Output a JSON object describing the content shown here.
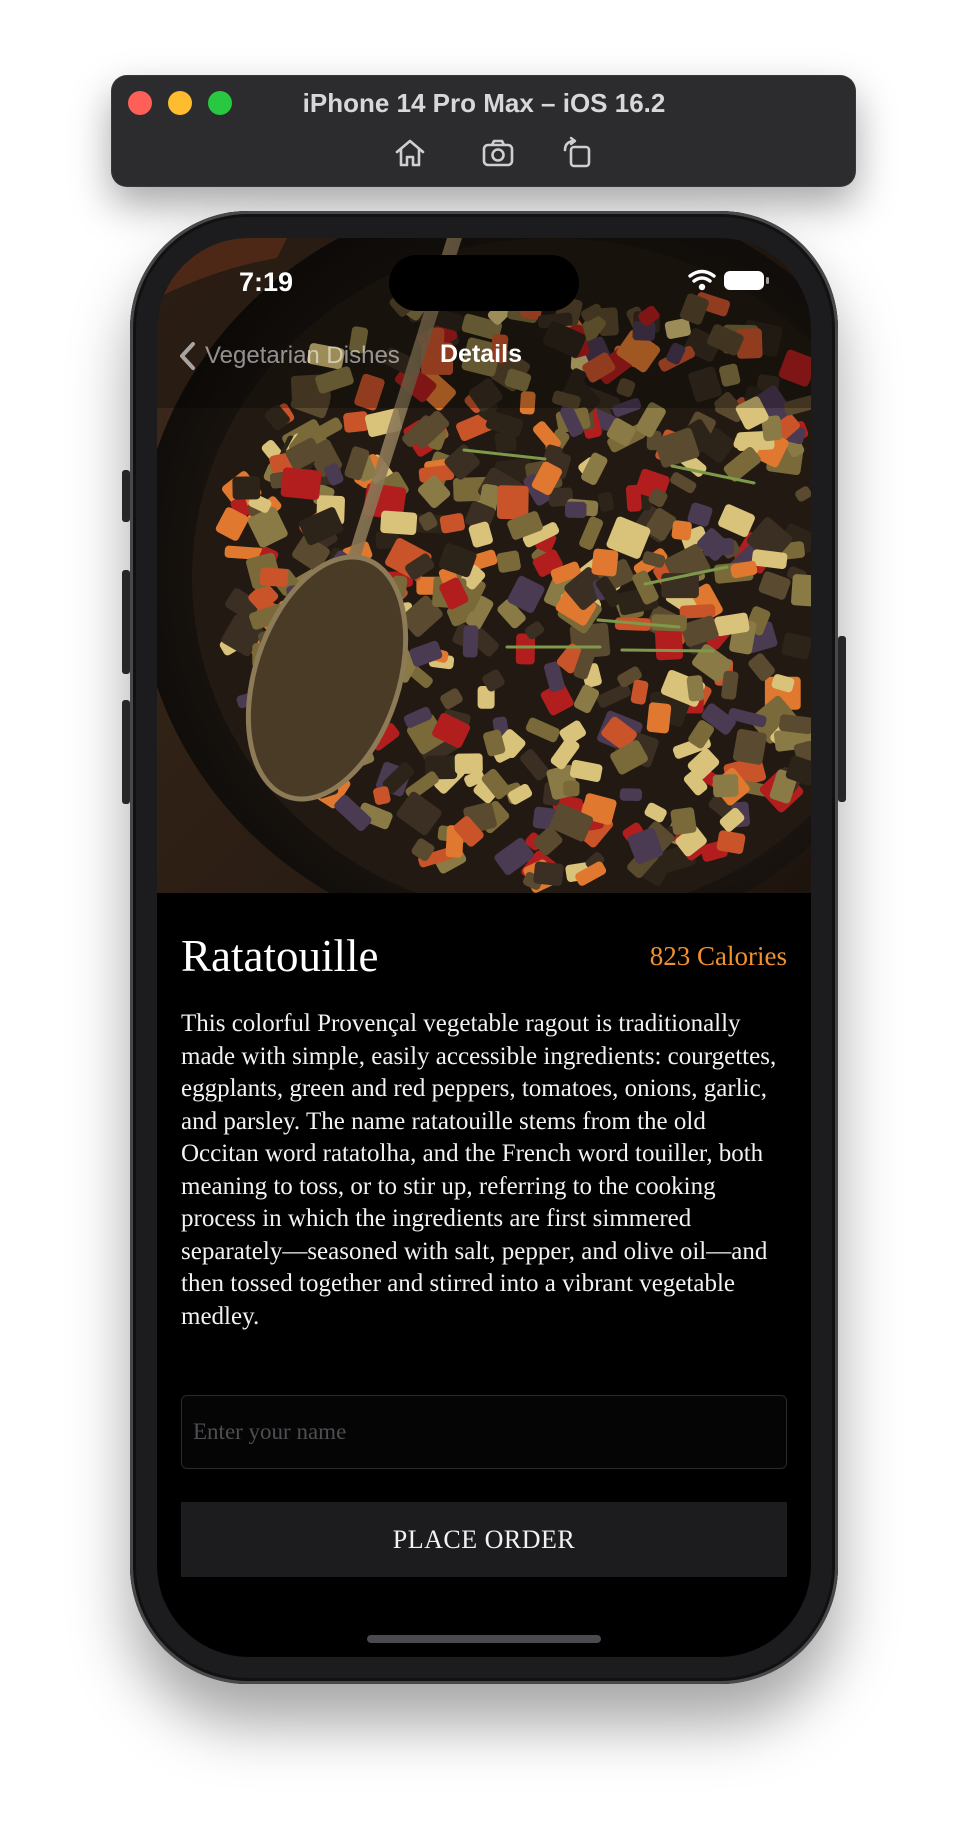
{
  "simulator": {
    "title": "iPhone 14 Pro Max – iOS 16.2",
    "toolbar_icons": [
      "home-icon",
      "screenshot-icon",
      "rotate-icon"
    ]
  },
  "status_bar": {
    "time": "7:19",
    "icons": [
      "wifi-icon",
      "battery-icon"
    ]
  },
  "nav": {
    "back_label": "Vegetarian Dishes",
    "title": "Details"
  },
  "dish": {
    "name": "Ratatouille",
    "calories": "823 Calories",
    "description": "This colorful Provençal vegetable ragout is traditionally made with simple, easily accessible ingredients: courgettes, eggplants, green and red peppers, tomatoes, onions, garlic, and parsley. The name ratatouille stems from the old Occitan word ratatolha, and the French word touiller, both meaning to toss, or to stir up, referring to the cooking process in which the ingredients are first simmered separately—seasoned with salt, pepper, and olive oil—and then tossed together and stirred into a vibrant vegetable medley."
  },
  "order_form": {
    "name_placeholder": "Enter your name",
    "name_value": "",
    "button_label": "PLACE ORDER"
  },
  "colors": {
    "accent": "#f0912f",
    "background": "#000000",
    "button": "#1c1c1e"
  }
}
